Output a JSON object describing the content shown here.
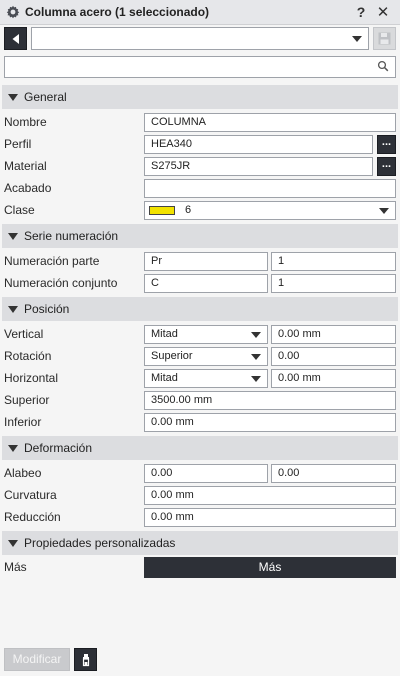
{
  "window": {
    "title": "Columna acero (1 seleccionado)",
    "help_label": "?",
    "close_label": "✕"
  },
  "toolbar": {
    "preset_value": "",
    "search_value": ""
  },
  "sections": {
    "general": "General",
    "numbering": "Serie numeración",
    "position": "Posición",
    "deformation": "Deformación",
    "custom": "Propiedades personalizadas"
  },
  "general": {
    "name_label": "Nombre",
    "name_value": "COLUMNA",
    "profile_label": "Perfil",
    "profile_value": "HEA340",
    "material_label": "Material",
    "material_value": "S275JR",
    "finish_label": "Acabado",
    "finish_value": "",
    "class_label": "Clase",
    "class_value": "6",
    "class_color": "#f2e200",
    "browse_label": "..."
  },
  "numbering": {
    "part_label": "Numeración parte",
    "part_prefix": "Pr",
    "part_start": "1",
    "assembly_label": "Numeración conjunto",
    "assembly_prefix": "C",
    "assembly_start": "1"
  },
  "position": {
    "vertical_label": "Vertical",
    "vertical_option": "Mitad",
    "vertical_offset": "0.00 mm",
    "rotation_label": "Rotación",
    "rotation_option": "Superior",
    "rotation_offset": "0.00",
    "horizontal_label": "Horizontal",
    "horizontal_option": "Mitad",
    "horizontal_offset": "0.00 mm",
    "top_label": "Superior",
    "top_value": "3500.00 mm",
    "bottom_label": "Inferior",
    "bottom_value": "0.00 mm"
  },
  "deformation": {
    "warping_label": "Alabeo",
    "warping_start": "0.00",
    "warping_end": "0.00",
    "camber_label": "Curvatura",
    "camber_value": "0.00 mm",
    "shortening_label": "Reducción",
    "shortening_value": "0.00 mm"
  },
  "custom": {
    "more_label": "Más",
    "more_button": "Más"
  },
  "footer": {
    "modify_label": "Modificar"
  }
}
